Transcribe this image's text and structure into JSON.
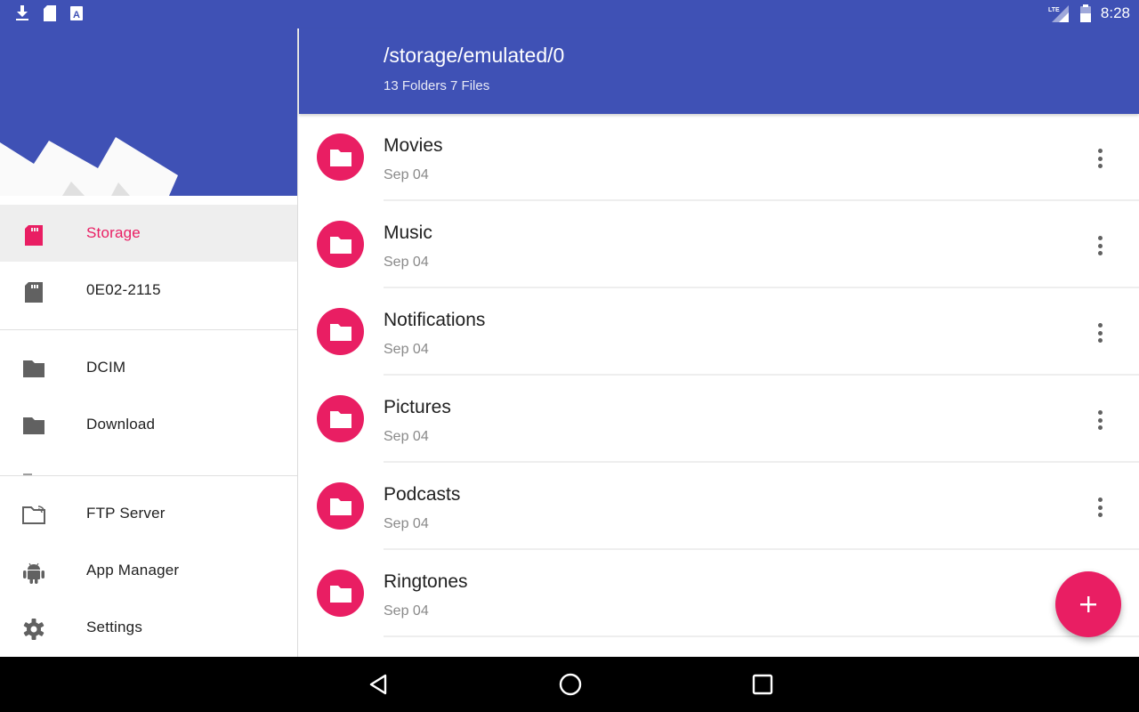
{
  "status_bar": {
    "notifications": [
      "download-icon",
      "sd-card-icon",
      "text-a-icon"
    ],
    "network": "LTE",
    "time": "8:28"
  },
  "drawer": {
    "storage_items": [
      {
        "label": "Storage",
        "icon": "sd-card-icon",
        "active": true
      },
      {
        "label": "0E02-2115",
        "icon": "sd-card-icon",
        "active": false
      }
    ],
    "bookmarks": [
      {
        "label": "DCIM",
        "icon": "folder-icon"
      },
      {
        "label": "Download",
        "icon": "folder-icon"
      }
    ],
    "tools": [
      {
        "label": "FTP Server",
        "icon": "ftp-folder-icon"
      },
      {
        "label": "App Manager",
        "icon": "android-icon"
      },
      {
        "label": "Settings",
        "icon": "gear-icon"
      }
    ]
  },
  "appbar": {
    "path": "/storage/emulated/0",
    "summary": "13 Folders 7 Files"
  },
  "files": [
    {
      "name": "Movies",
      "date": "Sep 04"
    },
    {
      "name": "Music",
      "date": "Sep 04"
    },
    {
      "name": "Notifications",
      "date": "Sep 04"
    },
    {
      "name": "Pictures",
      "date": "Sep 04"
    },
    {
      "name": "Podcasts",
      "date": "Sep 04"
    },
    {
      "name": "Ringtones",
      "date": "Sep 04"
    }
  ],
  "fab": {
    "icon": "plus-icon",
    "label": "+"
  },
  "navbar": {
    "buttons": [
      "back",
      "home",
      "recents"
    ]
  },
  "colors": {
    "primary": "#3f51b5",
    "accent": "#e91e63",
    "icon_grey": "#616161"
  }
}
